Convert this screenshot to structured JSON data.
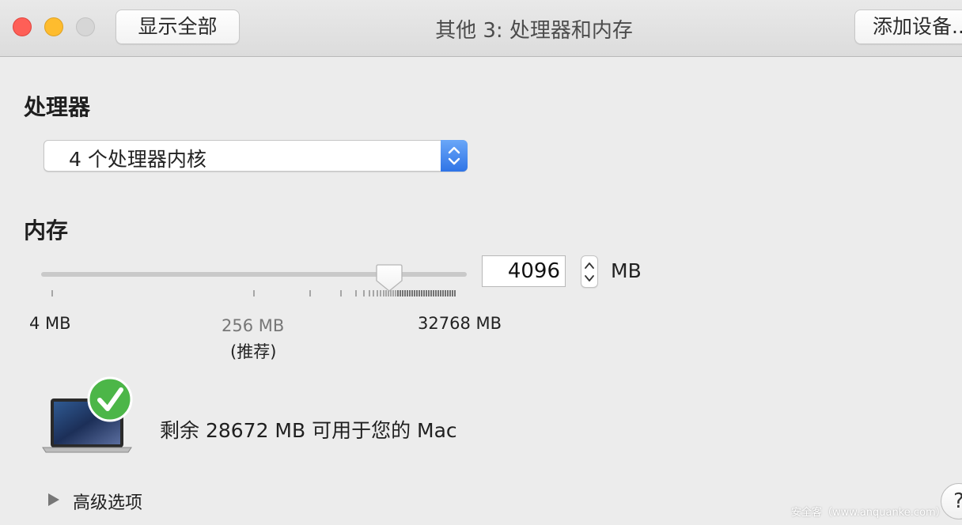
{
  "window": {
    "title": "其他 3: 处理器和内存",
    "show_all_button": "显示全部",
    "add_device_button": "添加设备..."
  },
  "processor": {
    "heading": "处理器",
    "cores_selected": "4 个处理器内核"
  },
  "memory": {
    "heading": "内存",
    "value": "4096",
    "unit": "MB",
    "slider": {
      "min_label": "4 MB",
      "recommended_label": "256 MB",
      "recommended_note": "(推荐)",
      "max_label": "32768 MB",
      "current_mb": 4096,
      "min_mb": 4,
      "max_mb": 32768
    }
  },
  "status": {
    "available_text": "剩余 28672 MB 可用于您的 Mac",
    "check_color": "#4cb648"
  },
  "advanced": {
    "label": "高级选项"
  },
  "watermark": "安全客（www.anquanke.com）",
  "icons": {
    "close": "close-traffic-light-icon",
    "minimize": "minimize-traffic-light-icon",
    "zoom": "zoom-traffic-light-icon",
    "popup_arrows": "chevron-updown-icon",
    "stepper": "chevron-updown-icon",
    "mac": "macbook-icon",
    "check": "checkmark-badge-icon",
    "disclosure": "disclosure-triangle-icon",
    "help": "help-icon"
  }
}
